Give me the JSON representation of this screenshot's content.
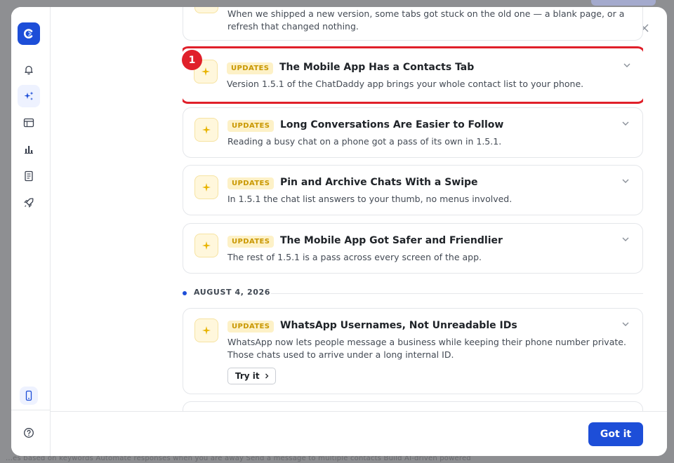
{
  "backdrop": {
    "bottom_text": "...es based on keywords        Automate responses when you are away        Send a message to multiple contacts        Build AI-driven powered"
  },
  "modal": {
    "rail": {
      "items": [
        {
          "icon": "bell-icon"
        },
        {
          "icon": "sparkles-icon",
          "active": true
        },
        {
          "icon": "calendar-icon"
        },
        {
          "icon": "bar-chart-icon"
        },
        {
          "icon": "document-icon"
        },
        {
          "icon": "rocket-icon"
        }
      ],
      "bottom": [
        {
          "icon": "mobile-icon"
        },
        {
          "icon": "help-icon"
        }
      ]
    },
    "top_partial_desc": "When we shipped a new version, some tabs got stuck on the old one — a blank page, or a refresh that changed nothing.",
    "marker_number": "1",
    "cards": [
      {
        "badge": "UPDATES",
        "title": "The Mobile App Has a Contacts Tab",
        "desc": "Version 1.5.1 of the ChatDaddy app brings your whole contact list to your phone."
      },
      {
        "badge": "UPDATES",
        "title": "Long Conversations Are Easier to Follow",
        "desc": "Reading a busy chat on a phone got a pass of its own in 1.5.1."
      },
      {
        "badge": "UPDATES",
        "title": "Pin and Archive Chats With a Swipe",
        "desc": "In 1.5.1 the chat list answers to your thumb, no menus involved."
      },
      {
        "badge": "UPDATES",
        "title": "The Mobile App Got Safer and Friendlier",
        "desc": "The rest of 1.5.1 is a pass across every screen of the app."
      }
    ],
    "date_label": "AUGUST 4, 2026",
    "dated_card": {
      "badge": "UPDATES",
      "title": "WhatsApp Usernames, Not Unreadable IDs",
      "desc": "WhatsApp now lets people message a business while keeping their phone number private. Those chats used to arrive under a long internal ID.",
      "try_label": "Try it"
    },
    "footer": {
      "got_it_label": "Got it"
    }
  },
  "colors": {
    "brand": "#1d4ed8",
    "highlight": "#e0202a",
    "badge_bg": "#fdf1c7",
    "badge_text": "#c99700"
  }
}
